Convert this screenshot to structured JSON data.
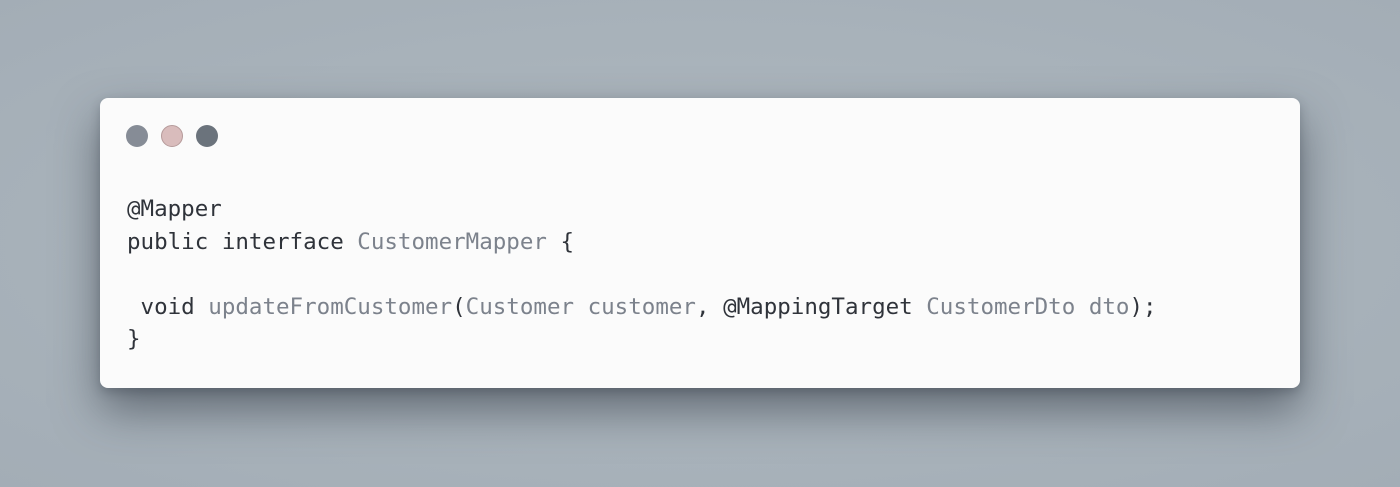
{
  "colors": {
    "background": "#a9b3bb",
    "window": "#fbfbfb",
    "text_plain": "#2f333a",
    "text_identifier": "#7c828c",
    "dot_close": "#868c96",
    "dot_minimize": "#d9bcbc",
    "dot_maximize": "#6b737c"
  },
  "window_controls": [
    "close-dot",
    "minimize-dot",
    "maximize-dot"
  ],
  "code": {
    "line1": {
      "annotation": "@Mapper"
    },
    "line2": {
      "kw_public": "public",
      "sp1": " ",
      "kw_interface": "interface",
      "sp2": " ",
      "class_name": "CustomerMapper",
      "brace_open": " {"
    },
    "line3": "",
    "line4": {
      "indent_void": " void",
      "sp1": " ",
      "method_name": "updateFromCustomer",
      "paren_open": "(",
      "param1_type": "Customer",
      "sp2": " ",
      "param1_name": "customer",
      "comma": ", ",
      "param2_annotation": "@MappingTarget",
      "sp3": " ",
      "param2_type": "CustomerDto",
      "sp4": " ",
      "param2_name": "dto",
      "paren_close": ");"
    },
    "line5": {
      "brace_close": "}"
    }
  }
}
